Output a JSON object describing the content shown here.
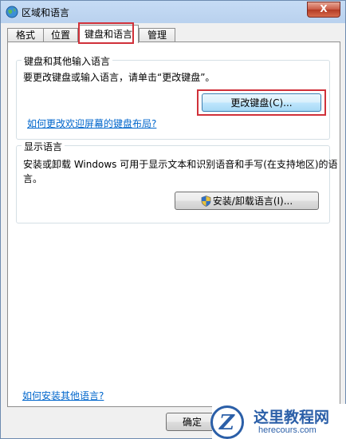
{
  "window": {
    "title": "区域和语言",
    "close_label": "X"
  },
  "tabs": [
    {
      "label": "格式"
    },
    {
      "label": "位置"
    },
    {
      "label": "键盘和语言"
    },
    {
      "label": "管理"
    }
  ],
  "active_tab": "键盘和语言",
  "keyboard_group": {
    "legend": "键盘和其他输入语言",
    "description": "要更改键盘或输入语言，请单击“更改键盘”。",
    "change_button": "更改键盘(C)...",
    "welcome_link": "如何更改欢迎屏幕的键盘布局?"
  },
  "display_group": {
    "legend": "显示语言",
    "description_line1": "安装或卸载 Windows 可用于显示文本和识别语音和手写(在支持地区)的语",
    "description_line2": "言。",
    "install_button": "安装/卸载语言(I)..."
  },
  "footer": {
    "more_languages_link": "如何安装其他语言?",
    "ok_button": "确定"
  },
  "watermark": {
    "title": "这里教程网",
    "subtitle": "herecours.com",
    "logo_letter": "Z"
  },
  "colors": {
    "highlight": "#d0313a",
    "link": "#0066cc",
    "brand": "#2b5fa8"
  }
}
